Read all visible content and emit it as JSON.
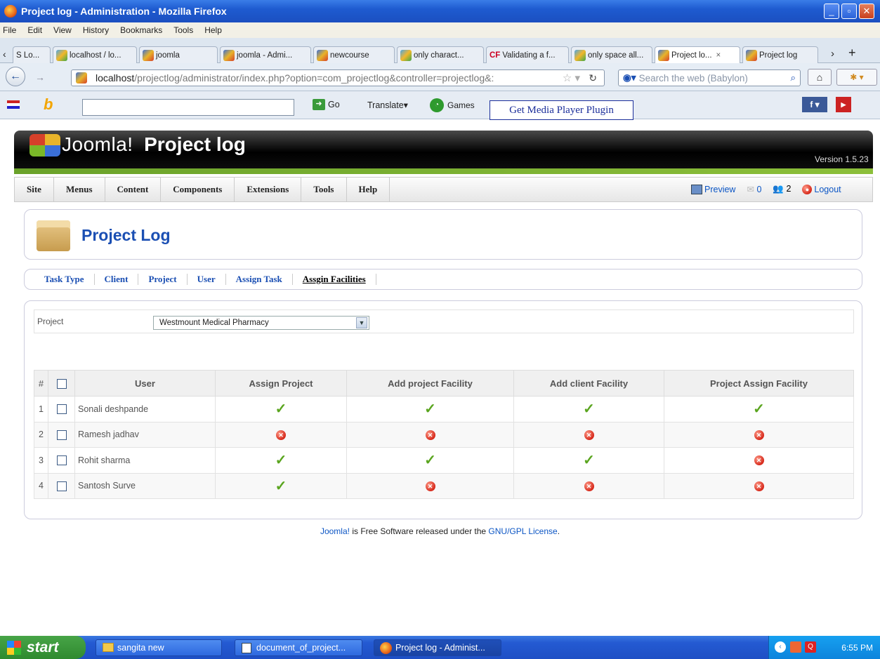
{
  "window": {
    "title": "Project log - Administration - Mozilla Firefox"
  },
  "menubar": [
    "File",
    "Edit",
    "View",
    "History",
    "Bookmarks",
    "Tools",
    "Help"
  ],
  "tabs": [
    {
      "label": "S Lo..."
    },
    {
      "label": "localhost / lo..."
    },
    {
      "label": "joomla"
    },
    {
      "label": "joomla - Admi..."
    },
    {
      "label": "newcourse"
    },
    {
      "label": "only charact..."
    },
    {
      "label": "Validating a f..."
    },
    {
      "label": "only space all..."
    },
    {
      "label": "Project lo..."
    },
    {
      "label": "Project log"
    }
  ],
  "tab_close": "×",
  "tab_plus": "+",
  "address": {
    "host": "localhost",
    "path": "/projectlog/administrator/index.php?option=com_projectlog&controller=projectlog&:"
  },
  "search": {
    "placeholder": "Search the web (Babylon)"
  },
  "toolbar": {
    "go_label": "Go",
    "translate_label": "Translate",
    "games_label": "Games",
    "media_label": "Get Media Player Plugin",
    "cf_label": "CF"
  },
  "joomla": {
    "brand": "Joomla!",
    "title": "Project log",
    "version": "Version 1.5.23",
    "menu": [
      "Site",
      "Menus",
      "Content",
      "Components",
      "Extensions",
      "Tools",
      "Help"
    ],
    "preview_label": "Preview",
    "messages_count": "0",
    "users_count": "2",
    "logout_label": "Logout"
  },
  "page": {
    "heading": "Project Log",
    "submenu": [
      "Task Type",
      "Client",
      "Project",
      "User",
      "Assign Task",
      "Assgin Facilities"
    ],
    "filter_label": "Project",
    "filter_value": "Westmount Medical Pharmacy"
  },
  "grid": {
    "headers": [
      "#",
      "User",
      "Assign Project",
      "Add project Facility",
      "Add client Facility",
      "Project Assign Facility"
    ],
    "rows": [
      {
        "num": "1",
        "user": "Sonali deshpande",
        "assign_project": true,
        "add_project_facility": true,
        "add_client_facility": true,
        "project_assign_facility": true
      },
      {
        "num": "2",
        "user": "Ramesh jadhav",
        "assign_project": false,
        "add_project_facility": false,
        "add_client_facility": false,
        "project_assign_facility": false
      },
      {
        "num": "3",
        "user": "Rohit sharma",
        "assign_project": true,
        "add_project_facility": true,
        "add_client_facility": true,
        "project_assign_facility": false
      },
      {
        "num": "4",
        "user": "Santosh Surve",
        "assign_project": true,
        "add_project_facility": false,
        "add_client_facility": false,
        "project_assign_facility": false
      }
    ]
  },
  "footer": {
    "link1": "Joomla!",
    "text": " is Free Software released under the ",
    "link2": "GNU/GPL License",
    "end": "."
  },
  "taskbar": {
    "start_label": "start",
    "items": [
      "sangita new",
      "document_of_project...",
      "Project log - Administ..."
    ],
    "clock": "6:55 PM"
  }
}
